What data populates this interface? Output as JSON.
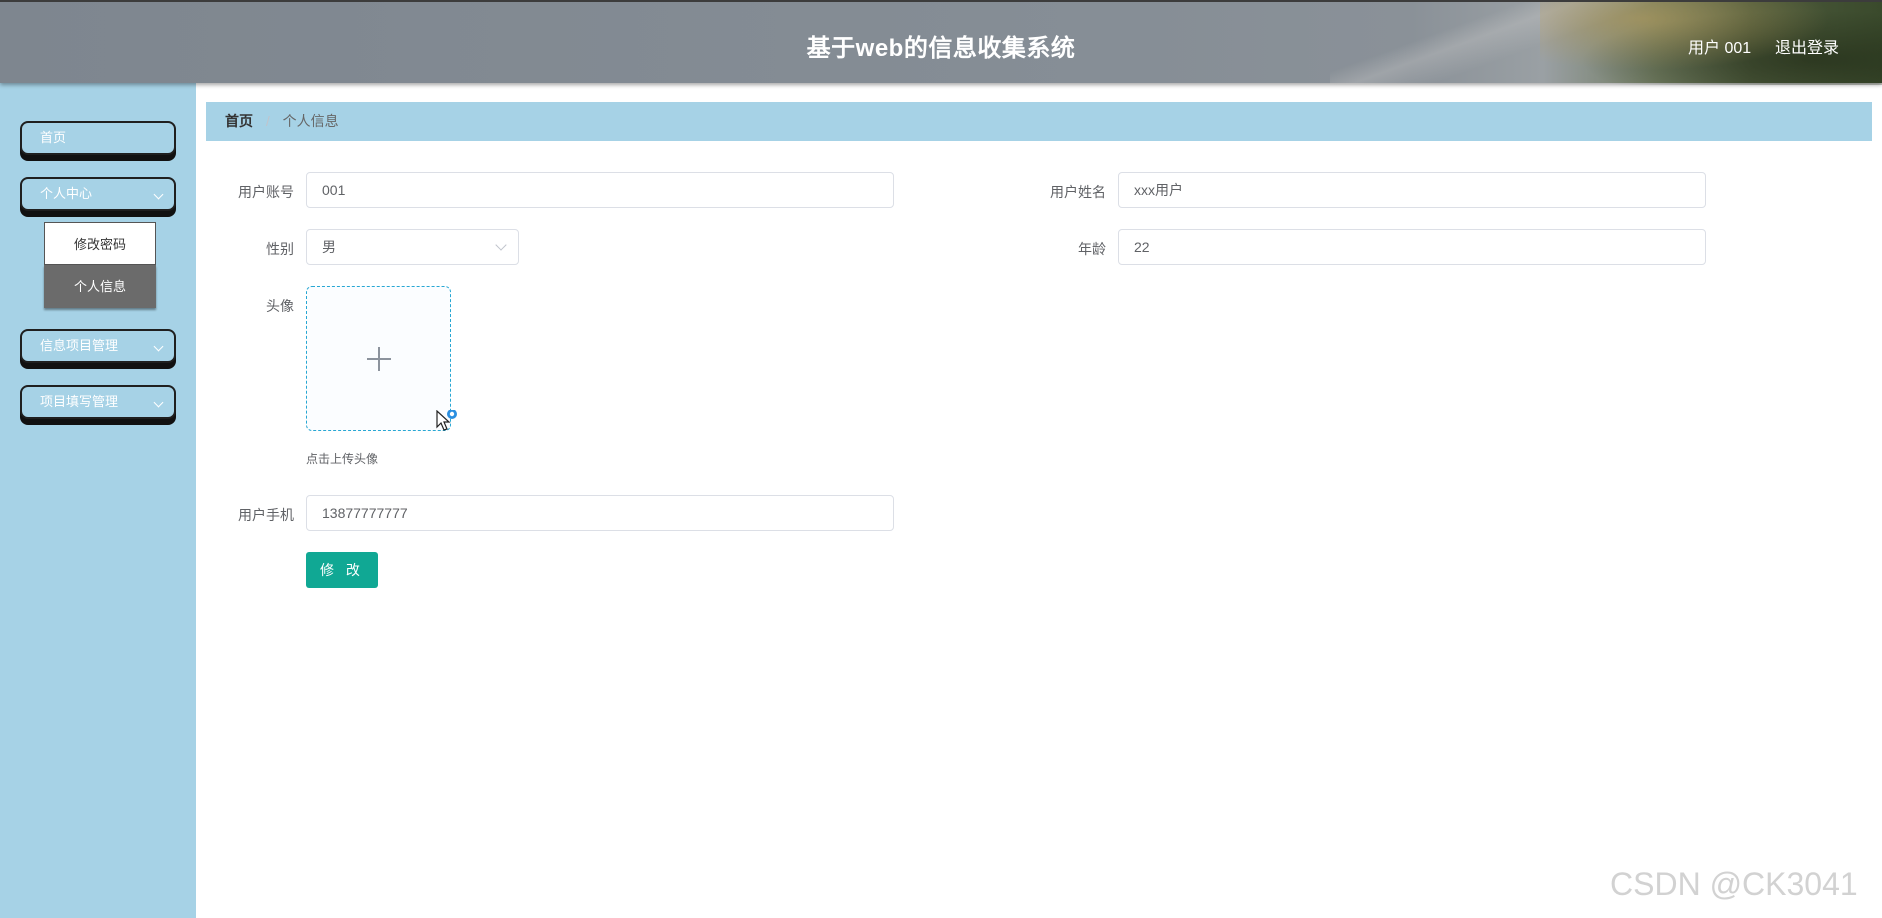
{
  "header": {
    "title": "基于web的信息收集系统",
    "user": "用户 001",
    "logout": "退出登录"
  },
  "sidebar": {
    "items": [
      {
        "label": "首页"
      },
      {
        "label": "个人中心",
        "children": [
          {
            "label": "修改密码"
          },
          {
            "label": "个人信息",
            "active": true
          }
        ]
      },
      {
        "label": "信息项目管理"
      },
      {
        "label": "项目填写管理"
      }
    ]
  },
  "breadcrumb": {
    "home": "首页",
    "separator": "/",
    "current": "个人信息"
  },
  "form": {
    "account_label": "用户账号",
    "account_value": "001",
    "name_label": "用户姓名",
    "name_value": "xxx用户",
    "gender_label": "性别",
    "gender_value": "男",
    "age_label": "年龄",
    "age_value": "22",
    "avatar_label": "头像",
    "avatar_tip": "点击上传头像",
    "phone_label": "用户手机",
    "phone_value": "13877777777",
    "submit_label": "修 改"
  },
  "watermark": "CSDN @CK3041",
  "colors": {
    "sidebar_bg": "#a6d2e6",
    "primary_button": "#10a894",
    "header_bg": "#868e96"
  }
}
